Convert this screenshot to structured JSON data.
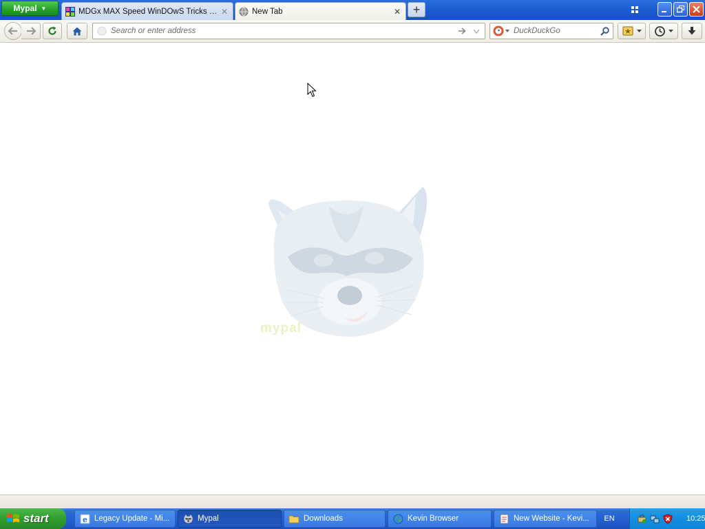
{
  "browser": {
    "app_menu_label": "Mypal",
    "tabs": [
      {
        "title": "MDGx MAX Speed WinDOwS Tricks + Sec...",
        "active": false
      },
      {
        "title": "New Tab",
        "active": true
      }
    ],
    "new_tab_symbol": "+"
  },
  "navbar": {
    "url_placeholder": "Search or enter address",
    "search_engine": "DuckDuckGo",
    "search_placeholder": "DuckDuckGo"
  },
  "content": {
    "mascot": "raccoon-mascot",
    "watermark": "mypal"
  },
  "taskbar": {
    "start_label": "start",
    "tasks": [
      {
        "label": "Legacy Update - Mi...",
        "icon": "ie-icon",
        "active": false
      },
      {
        "label": "Mypal",
        "icon": "raccoon-icon",
        "active": true
      },
      {
        "label": "Downloads",
        "icon": "folder-icon",
        "active": false
      },
      {
        "label": "Kevin Browser",
        "icon": "globe-icon",
        "active": false
      },
      {
        "label": "New Website - Kevi...",
        "icon": "document-icon",
        "active": false
      }
    ],
    "language": "EN",
    "clock": "10:25"
  },
  "colors": {
    "taskbar_blue": "#245ed0",
    "start_green": "#2f9e2d",
    "app_menu_green": "#26a52a",
    "tray_blue": "#138ee0"
  }
}
